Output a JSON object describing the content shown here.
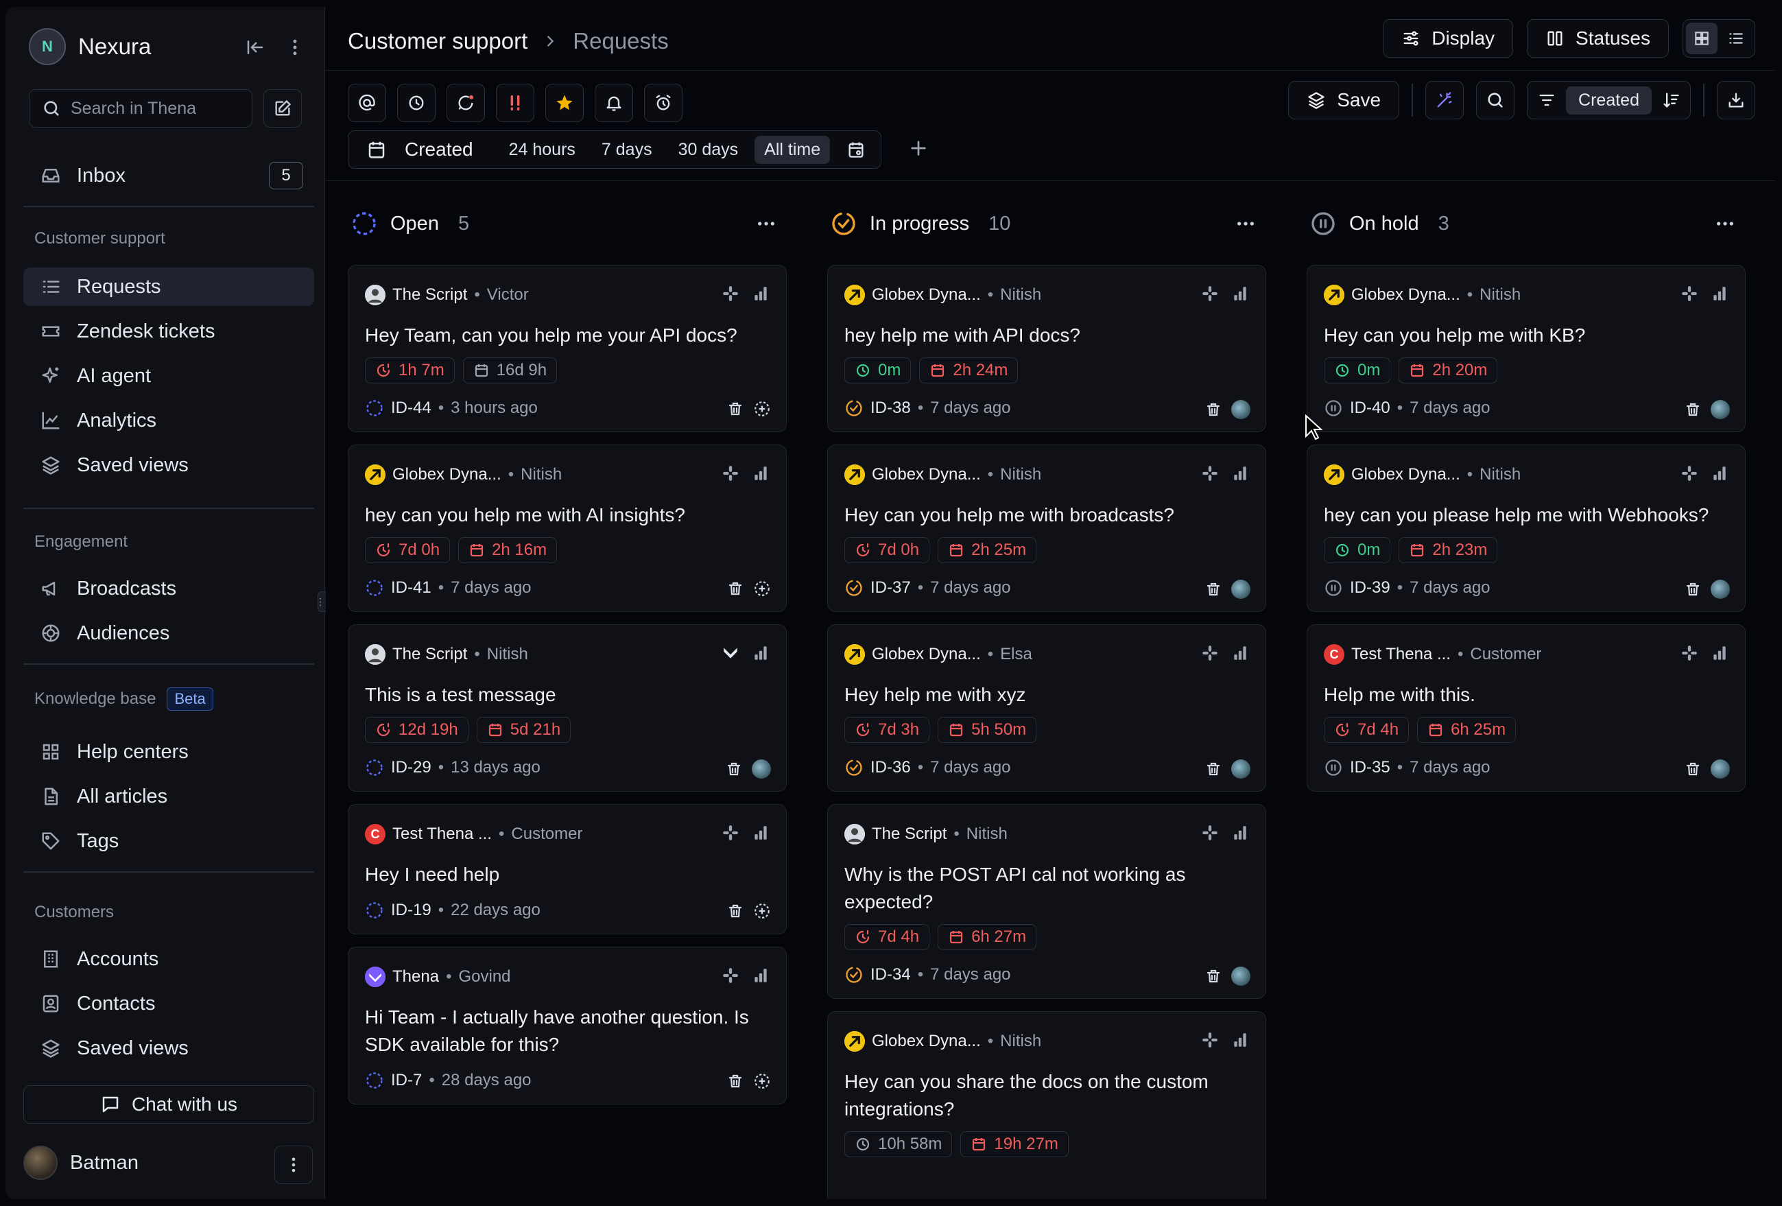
{
  "sidebar": {
    "brand": {
      "name": "Nexura",
      "logo_letter": "N"
    },
    "search_placeholder": "Search in Thena",
    "inbox": {
      "label": "Inbox",
      "count": "5"
    },
    "sections": {
      "customer_support": "Customer support",
      "engagement": "Engagement",
      "knowledge_base": "Knowledge base",
      "knowledge_badge": "Beta",
      "customers": "Customers"
    },
    "items": {
      "requests": "Requests",
      "zendesk": "Zendesk tickets",
      "ai_agent": "AI agent",
      "analytics": "Analytics",
      "saved_views": "Saved views",
      "broadcasts": "Broadcasts",
      "audiences": "Audiences",
      "help_centers": "Help centers",
      "all_articles": "All articles",
      "tags": "Tags",
      "accounts": "Accounts",
      "contacts": "Contacts",
      "saved_views_2": "Saved views"
    },
    "chat_label": "Chat with us",
    "user_name": "Batman"
  },
  "header": {
    "crumb_1": "Customer support",
    "crumb_2": "Requests",
    "display_label": "Display",
    "statuses_label": "Statuses",
    "save_label": "Save",
    "sort_label": "Created"
  },
  "date_filter": {
    "label": "Created",
    "ranges": [
      "24 hours",
      "7 days",
      "30 days",
      "All time"
    ],
    "selected": "All time"
  },
  "colors": {
    "accent_open": "#5b6cff",
    "accent_progress": "#f0a030",
    "sla_breach": "#f25c5c",
    "sla_ok": "#3ccf8e"
  },
  "columns": [
    {
      "title": "Open",
      "count": "5",
      "cards": [
        {
          "org": "The Script",
          "logo": "script",
          "person": "Victor",
          "title": "Hey Team, can you help me your API docs?",
          "chips": [
            {
              "text": "1h 7m",
              "tone": "red",
              "icon": "clock-alert"
            },
            {
              "text": "16d 9h",
              "tone": "gray",
              "icon": "calendar"
            }
          ],
          "id": "ID-44",
          "ago": "3 hours ago",
          "right_icon": "slack"
        },
        {
          "org": "Globex Dyna...",
          "logo": "globex",
          "person": "Nitish",
          "title": "hey can you help me with AI insights?",
          "chips": [
            {
              "text": "7d 0h",
              "tone": "red",
              "icon": "clock-alert"
            },
            {
              "text": "2h 16m",
              "tone": "red",
              "icon": "calendar"
            }
          ],
          "id": "ID-41",
          "ago": "7 days ago",
          "right_icon": "slack"
        },
        {
          "org": "The Script",
          "logo": "script",
          "person": "Nitish",
          "title": "This is a test message",
          "chips": [
            {
              "text": "12d 19h",
              "tone": "red",
              "icon": "clock-alert"
            },
            {
              "text": "5d 21h",
              "tone": "red",
              "icon": "calendar"
            }
          ],
          "id": "ID-29",
          "ago": "13 days ago",
          "right_icon": "thena"
        },
        {
          "org": "Test Thena ...",
          "logo": "test",
          "person": "Customer",
          "title": "Hey I need help",
          "chips": [],
          "id": "ID-19",
          "ago": "22 days ago",
          "right_icon": "slack"
        },
        {
          "org": "Thena",
          "logo": "thena",
          "person": "Govind",
          "title": "Hi Team - I actually have another question. Is SDK available for this?",
          "chips": [],
          "id": "ID-7",
          "ago": "28 days ago",
          "right_icon": "slack"
        }
      ]
    },
    {
      "title": "In progress",
      "count": "10",
      "cards": [
        {
          "org": "Globex Dyna...",
          "logo": "globex",
          "person": "Nitish",
          "title": "hey help me with API docs?",
          "chips": [
            {
              "text": "0m",
              "tone": "green",
              "icon": "clock"
            },
            {
              "text": "2h 24m",
              "tone": "red",
              "icon": "calendar"
            }
          ],
          "id": "ID-38",
          "ago": "7 days ago",
          "right_icon": "slack"
        },
        {
          "org": "Globex Dyna...",
          "logo": "globex",
          "person": "Nitish",
          "title": "Hey can you help me with broadcasts?",
          "chips": [
            {
              "text": "7d 0h",
              "tone": "red",
              "icon": "clock-alert"
            },
            {
              "text": "2h 25m",
              "tone": "red",
              "icon": "calendar"
            }
          ],
          "id": "ID-37",
          "ago": "7 days ago",
          "right_icon": "slack"
        },
        {
          "org": "Globex Dyna...",
          "logo": "globex",
          "person": "Elsa",
          "title": "Hey help me with xyz",
          "chips": [
            {
              "text": "7d 3h",
              "tone": "red",
              "icon": "clock-alert"
            },
            {
              "text": "5h 50m",
              "tone": "red",
              "icon": "calendar"
            }
          ],
          "id": "ID-36",
          "ago": "7 days ago",
          "right_icon": "slack"
        },
        {
          "org": "The Script",
          "logo": "script",
          "person": "Nitish",
          "title": "Why is the POST API cal not working as expected?",
          "chips": [
            {
              "text": "7d 4h",
              "tone": "red",
              "icon": "clock-alert"
            },
            {
              "text": "6h 27m",
              "tone": "red",
              "icon": "calendar"
            }
          ],
          "id": "ID-34",
          "ago": "7 days ago",
          "right_icon": "slack"
        },
        {
          "org": "Globex Dyna...",
          "logo": "globex",
          "person": "Nitish",
          "title": "Hey can you share the docs on the custom integrations?",
          "chips": [
            {
              "text": "10h 58m",
              "tone": "gray",
              "icon": "clock"
            },
            {
              "text": "19h 27m",
              "tone": "red",
              "icon": "calendar"
            }
          ],
          "id": "",
          "ago": "",
          "right_icon": "slack"
        }
      ]
    },
    {
      "title": "On hold",
      "count": "3",
      "cards": [
        {
          "org": "Globex Dyna...",
          "logo": "globex",
          "person": "Nitish",
          "title": "Hey can you help me with KB?",
          "chips": [
            {
              "text": "0m",
              "tone": "green",
              "icon": "clock"
            },
            {
              "text": "2h 20m",
              "tone": "red",
              "icon": "calendar"
            }
          ],
          "id": "ID-40",
          "ago": "7 days ago",
          "right_icon": "slack"
        },
        {
          "org": "Globex Dyna...",
          "logo": "globex",
          "person": "Nitish",
          "title": "hey can you please help me with Webhooks?",
          "chips": [
            {
              "text": "0m",
              "tone": "green",
              "icon": "clock"
            },
            {
              "text": "2h 23m",
              "tone": "red",
              "icon": "calendar"
            }
          ],
          "id": "ID-39",
          "ago": "7 days ago",
          "right_icon": "slack"
        },
        {
          "org": "Test Thena ...",
          "logo": "test",
          "person": "Customer",
          "title": "Help me with this.",
          "chips": [
            {
              "text": "7d 4h",
              "tone": "red",
              "icon": "clock-alert"
            },
            {
              "text": "6h 25m",
              "tone": "red",
              "icon": "calendar"
            }
          ],
          "id": "ID-35",
          "ago": "7 days ago",
          "right_icon": "slack"
        }
      ]
    }
  ]
}
